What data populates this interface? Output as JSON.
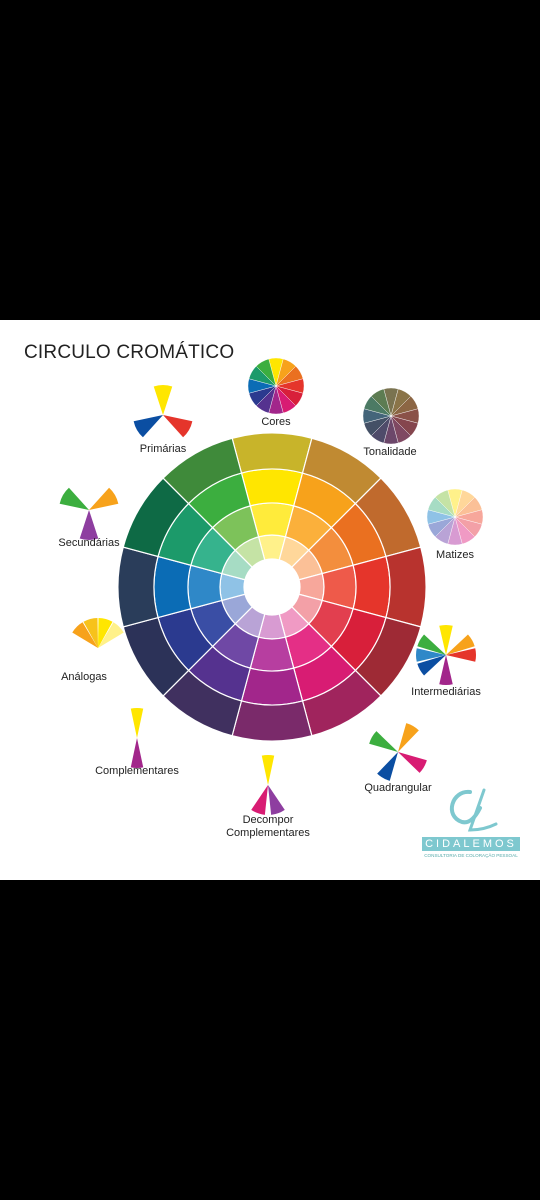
{
  "title": "CIRCULO CROMÁTICO",
  "labels": {
    "cores": "Cores",
    "tonalidade": "Tonalidade",
    "primarias": "Primárias",
    "secundarias": "Secundárias",
    "matizes": "Matizes",
    "analogas": "Análogas",
    "intermediarias": "Intermediárias",
    "complementares": "Complementares",
    "quadrangular": "Quadrangular",
    "decompor_line1": "Decompor",
    "decompor_line2": "Complementares"
  },
  "logo": {
    "name": "CIDALEMOS",
    "tagline": "CONSULTORIA DE COLORAÇÃO PESSOAL",
    "monogram": "CL",
    "accent": "#7ec8cf"
  },
  "wheel": {
    "hue_colors": [
      [
        "#fff18a",
        "#ffeb3b",
        "#ffe600",
        "#c8b42a"
      ],
      [
        "#ffd79a",
        "#fbb03b",
        "#f7a21b",
        "#c08a32"
      ],
      [
        "#fbc097",
        "#f38e3d",
        "#ea7020",
        "#c06a2d"
      ],
      [
        "#f7a79b",
        "#ee5a4a",
        "#e5352b",
        "#b8332e"
      ],
      [
        "#f3a0a7",
        "#e23f4f",
        "#d81f3a",
        "#9e2a35"
      ],
      [
        "#f09ac4",
        "#e42f86",
        "#d81c73",
        "#a0245d"
      ],
      [
        "#d89bd2",
        "#b73ea0",
        "#a2268b",
        "#7a2a6a"
      ],
      [
        "#b9a3d6",
        "#6f48a5",
        "#55328f",
        "#40305f"
      ],
      [
        "#9aa7d8",
        "#3a4ea5",
        "#2b3a8f",
        "#2c3258"
      ],
      [
        "#8fc2e6",
        "#2f88c8",
        "#0b6cb5",
        "#2a3d5a"
      ],
      [
        "#a6dcc4",
        "#36b38d",
        "#1c9a6a",
        "#0e6a45"
      ],
      [
        "#c5e3a5",
        "#7dc25a",
        "#3cae3f",
        "#3f8a3a"
      ]
    ]
  }
}
